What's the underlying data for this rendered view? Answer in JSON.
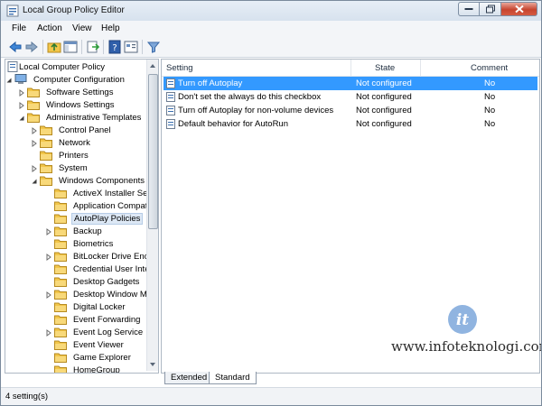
{
  "window": {
    "title": "Local Group Policy Editor"
  },
  "menu": {
    "items": [
      "File",
      "Action",
      "View",
      "Help"
    ]
  },
  "tree": {
    "root": "Local Computer Policy",
    "items": [
      {
        "label": "Computer Configuration",
        "level": 1,
        "expanded": true,
        "icon": "computer-icon"
      },
      {
        "label": "Software Settings",
        "level": 2,
        "expanded": false
      },
      {
        "label": "Windows Settings",
        "level": 2,
        "expanded": false
      },
      {
        "label": "Administrative Templates",
        "level": 2,
        "expanded": true
      },
      {
        "label": "Control Panel",
        "level": 3,
        "expanded": false
      },
      {
        "label": "Network",
        "level": 3,
        "expanded": false
      },
      {
        "label": "Printers",
        "level": 3,
        "expanded": null
      },
      {
        "label": "System",
        "level": 3,
        "expanded": false
      },
      {
        "label": "Windows Components",
        "level": 3,
        "expanded": true
      },
      {
        "label": "ActiveX Installer Serv",
        "level": 4,
        "expanded": null
      },
      {
        "label": "Application Compat",
        "level": 4,
        "expanded": null
      },
      {
        "label": "AutoPlay Policies",
        "level": 4,
        "expanded": null,
        "selected": true
      },
      {
        "label": "Backup",
        "level": 4,
        "expanded": false
      },
      {
        "label": "Biometrics",
        "level": 4,
        "expanded": null
      },
      {
        "label": "BitLocker Drive Encry",
        "level": 4,
        "expanded": false
      },
      {
        "label": "Credential User Inter",
        "level": 4,
        "expanded": null
      },
      {
        "label": "Desktop Gadgets",
        "level": 4,
        "expanded": null
      },
      {
        "label": "Desktop Window Ma",
        "level": 4,
        "expanded": false
      },
      {
        "label": "Digital Locker",
        "level": 4,
        "expanded": null
      },
      {
        "label": "Event Forwarding",
        "level": 4,
        "expanded": null
      },
      {
        "label": "Event Log Service",
        "level": 4,
        "expanded": false
      },
      {
        "label": "Event Viewer",
        "level": 4,
        "expanded": null
      },
      {
        "label": "Game Explorer",
        "level": 4,
        "expanded": null
      },
      {
        "label": "HomeGroup",
        "level": 4,
        "expanded": null
      }
    ]
  },
  "list": {
    "columns": [
      "Setting",
      "State",
      "Comment"
    ],
    "rows": [
      {
        "setting": "Turn off Autoplay",
        "state": "Not configured",
        "comment": "No",
        "selected": true
      },
      {
        "setting": "Don't set the always do this checkbox",
        "state": "Not configured",
        "comment": "No"
      },
      {
        "setting": "Turn off Autoplay for non-volume devices",
        "state": "Not configured",
        "comment": "No"
      },
      {
        "setting": "Default behavior for AutoRun",
        "state": "Not configured",
        "comment": "No"
      }
    ]
  },
  "tabs": [
    "Extended",
    "Standard"
  ],
  "status": "4 setting(s)",
  "watermark": {
    "logo": "it",
    "text": "www.infoteknologi.com"
  },
  "colors": {
    "selection": "#3399ff",
    "folder": "#f2c64a",
    "close": "#c7452f"
  }
}
